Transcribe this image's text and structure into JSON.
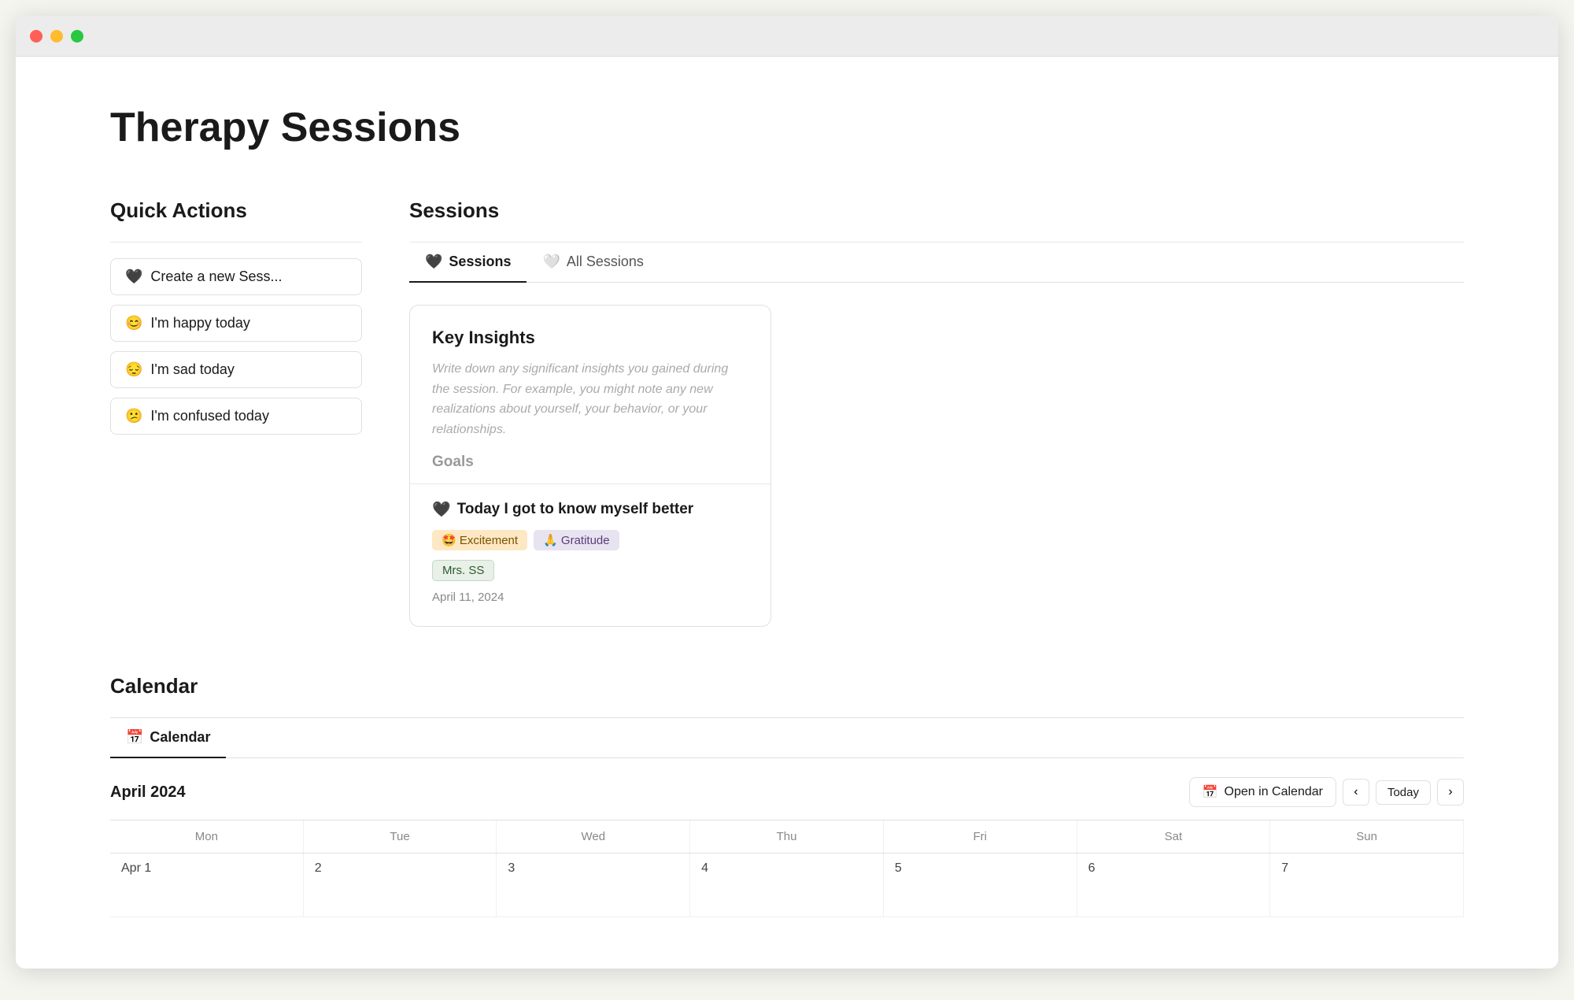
{
  "window": {
    "title": "Therapy Sessions"
  },
  "page": {
    "title": "Therapy Sessions"
  },
  "quickActions": {
    "sectionTitle": "Quick Actions",
    "buttons": [
      {
        "id": "create-session",
        "emoji": "🖤",
        "label": "Create a new Sess..."
      },
      {
        "id": "happy",
        "emoji": "😊",
        "label": "I'm happy today"
      },
      {
        "id": "sad",
        "emoji": "😔",
        "label": "I'm sad today"
      },
      {
        "id": "confused",
        "emoji": "😕",
        "label": "I'm confused today"
      }
    ]
  },
  "sessions": {
    "sectionTitle": "Sessions",
    "tabs": [
      {
        "id": "sessions",
        "emoji": "🖤",
        "label": "Sessions",
        "active": true
      },
      {
        "id": "all-sessions",
        "emoji": "🤍",
        "label": "All Sessions",
        "active": false
      }
    ],
    "card": {
      "keyInsightsTitle": "Key Insights",
      "keyInsightsPlaceholder": "Write down any significant insights you gained during the session. For example, you might note any new realizations about yourself, your behavior, or your relationships.",
      "goalsTitle": "Goals",
      "sessionTitle": "Today I got to know myself better",
      "sessionEmoji": "🖤",
      "tags": [
        {
          "emoji": "🤩",
          "label": "Excitement",
          "type": "excitement"
        },
        {
          "emoji": "🙏",
          "label": "Gratitude",
          "type": "gratitude"
        }
      ],
      "person": "Mrs. SS",
      "date": "April 11, 2024"
    }
  },
  "calendar": {
    "sectionTitle": "Calendar",
    "tabLabel": "Calendar",
    "tabEmoji": "📅",
    "monthYear": "April 2024",
    "openCalendarLabel": "Open in Calendar",
    "todayLabel": "Today",
    "dayHeaders": [
      "Mon",
      "Tue",
      "Wed",
      "Thu",
      "Fri",
      "Sat",
      "Sun"
    ],
    "rows": [
      [
        "Apr 1",
        "2",
        "3",
        "4",
        "5",
        "6",
        "7"
      ]
    ]
  }
}
